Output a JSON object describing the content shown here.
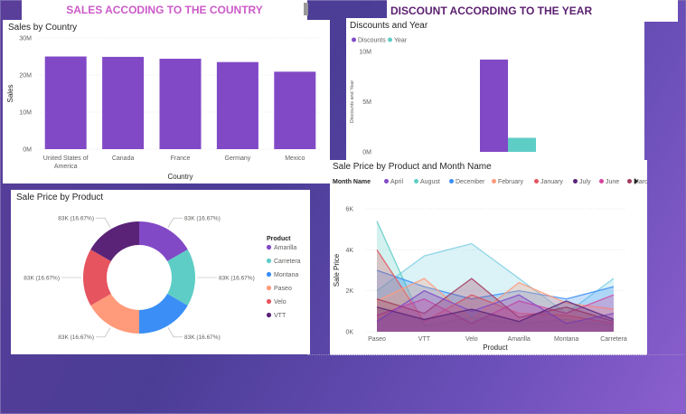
{
  "headers": {
    "sales_title": "SALES ACCODING TO THE COUNTRY",
    "discount_title": "DISCOUNT ACCORDING TO THE YEAR"
  },
  "colors": {
    "purple": "#8149c6",
    "teal": "#5ecdc6",
    "blue": "#3a8ef5",
    "salmon": "#ff9a7a",
    "red": "#e5545f",
    "darkpurple": "#5a2378",
    "pink": "#d6459e",
    "maroon": "#a33a5c"
  },
  "chart_data": [
    {
      "id": "sales-by-country",
      "type": "bar",
      "title": "Sales by Country",
      "xlabel": "Country",
      "ylabel": "Sales",
      "categories": [
        "United States of America",
        "Canada",
        "France",
        "Germany",
        "Mexico"
      ],
      "category_lines": [
        [
          "United States of",
          "America"
        ],
        [
          "Canada"
        ],
        [
          "France"
        ],
        [
          "Germany"
        ],
        [
          "Mexico"
        ]
      ],
      "values": [
        25.0,
        24.9,
        24.4,
        23.5,
        20.9
      ],
      "value_unit": "M",
      "yticks": [
        "0M",
        "10M",
        "20M",
        "30M"
      ],
      "ylim": [
        0,
        30
      ]
    },
    {
      "id": "discounts-and-year",
      "type": "bar",
      "title": "Discounts and Year",
      "ylabel": "Discounts and Year",
      "series": [
        {
          "name": "Discounts",
          "values": [
            9.2
          ]
        },
        {
          "name": "Year",
          "values": [
            1.4
          ]
        }
      ],
      "yticks": [
        "0M",
        "5M",
        "10M"
      ],
      "ylim": [
        0,
        10
      ]
    },
    {
      "id": "sale-price-by-product",
      "type": "pie",
      "title": "Sale Price by Product",
      "legend_title": "Product",
      "labels": [
        "Amarilla",
        "Carretera",
        "Montana",
        "Paseo",
        "Velo",
        "VTT"
      ],
      "values": [
        83,
        83,
        83,
        83,
        83,
        83
      ],
      "data_labels": [
        "83K (16.67%)",
        "83K (16.67%)",
        "83K (16.67%)",
        "83K (16.67%)",
        "83K (16.67%)",
        "83K (16.67%)"
      ]
    },
    {
      "id": "sale-price-by-product-month",
      "type": "area",
      "title": "Sale Price by Product and Month Name",
      "legend_title": "Month Name",
      "xlabel": "Product",
      "ylabel": "Sale Price",
      "categories": [
        "Paseo",
        "VTT",
        "Velo",
        "Amarilla",
        "Montana",
        "Carretera"
      ],
      "yticks": [
        "0K",
        "2K",
        "4K",
        "6K"
      ],
      "ylim": [
        0,
        6
      ],
      "series": [
        {
          "name": "April",
          "values": [
            0.5,
            2.0,
            1.0,
            1.8,
            0.4,
            0.9
          ]
        },
        {
          "name": "August",
          "values": [
            5.4,
            0.3,
            0.7,
            0.4,
            0.6,
            0.3
          ]
        },
        {
          "name": "December",
          "values": [
            3.0,
            2.2,
            1.6,
            2.0,
            1.6,
            2.2
          ]
        },
        {
          "name": "February",
          "values": [
            1.5,
            2.6,
            0.6,
            2.4,
            1.4,
            1.1
          ]
        },
        {
          "name": "January",
          "values": [
            4.0,
            0.5,
            1.8,
            0.9,
            0.8,
            0.4
          ]
        },
        {
          "name": "July",
          "values": [
            1.2,
            0.6,
            1.1,
            0.5,
            1.5,
            0.6
          ]
        },
        {
          "name": "June",
          "values": [
            0.8,
            1.6,
            0.4,
            1.5,
            0.9,
            1.8
          ]
        },
        {
          "name": "March",
          "values": [
            1.6,
            0.9,
            2.6,
            0.7,
            1.2,
            0.5
          ]
        },
        {
          "name": "",
          "values": [
            2.0,
            3.7,
            4.3,
            2.6,
            0.9,
            2.6
          ]
        }
      ]
    }
  ]
}
